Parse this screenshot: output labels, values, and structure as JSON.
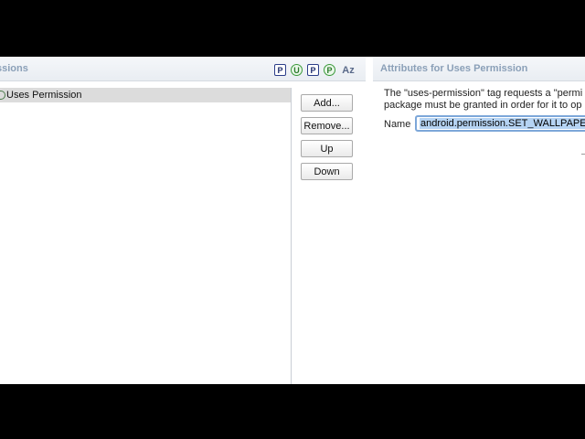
{
  "left_panel": {
    "title": "ssions",
    "toolbar": {
      "icons": [
        {
          "name": "p-icon",
          "glyph": "P"
        },
        {
          "name": "u-icon",
          "glyph": "U"
        },
        {
          "name": "p-icon",
          "glyph": "P"
        },
        {
          "name": "p-circle-icon",
          "glyph": "P"
        },
        {
          "name": "sort-az-icon",
          "glyph": "Az"
        }
      ]
    },
    "tree": {
      "items": [
        {
          "label": "Uses Permission",
          "selected": true
        }
      ]
    },
    "buttons": {
      "add": "Add...",
      "remove": "Remove...",
      "up": "Up",
      "down": "Down"
    }
  },
  "right_panel": {
    "title": "Attributes for Uses Permission",
    "description_line1": "The \"uses-permission\" tag requests a \"permi",
    "description_line2": "package must be granted in order for it to op",
    "name_label": "Name",
    "name_value": "android.permission.SET_WALLPAPER"
  },
  "colors": {
    "header_text": "#8ba0b8",
    "selection": "#dcdcdc",
    "input_focus": "#7da7d9"
  }
}
